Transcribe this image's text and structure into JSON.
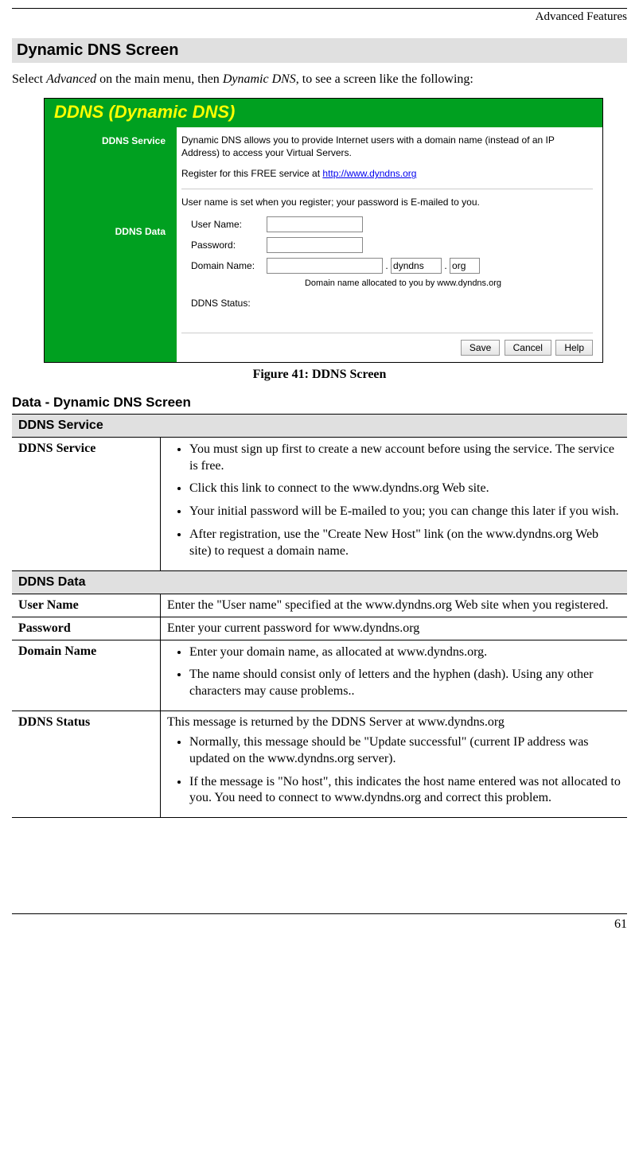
{
  "header": {
    "chapter": "Advanced Features"
  },
  "section": {
    "title": "Dynamic DNS Screen"
  },
  "intro": {
    "pre": "Select ",
    "em1": "Advanced",
    "mid": " on the main menu, then ",
    "em2": "Dynamic DNS",
    "post": ", to see a screen like the following:"
  },
  "screenshot": {
    "title": "DDNS (Dynamic DNS)",
    "side1": "DDNS Service",
    "side2": "DDNS Data",
    "desc1": "Dynamic DNS allows you to provide Internet users with a domain name (instead of an IP Address) to access your Virtual Servers.",
    "desc2a": "Register for this FREE service at ",
    "desc2link": "http://www.dyndns.org",
    "desc3": "User name is set when you register; your password is E-mailed to you.",
    "lbl_user": "User Name:",
    "lbl_pass": "Password:",
    "lbl_domain": "Domain Name:",
    "dom2": "dyndns",
    "dom3": "org",
    "dom_caption": "Domain name allocated to you by www.dyndns.org",
    "lbl_status": "DDNS Status:",
    "btn_save": "Save",
    "btn_cancel": "Cancel",
    "btn_help": "Help"
  },
  "figure": {
    "caption": "Figure 41: DDNS Screen"
  },
  "subsection": {
    "title": "Data - Dynamic DNS Screen"
  },
  "table": {
    "h1": "DDNS Service",
    "r1_label": "DDNS Service",
    "r1_b1": "You must sign up first to create a new account before using the service. The service is free.",
    "r1_b2": "Click this link to connect to the www.dyndns.org Web site.",
    "r1_b3": "Your initial password will be E-mailed to you; you can change this later if you wish.",
    "r1_b4": "After registration, use the \"Create New Host\" link (on the www.dyndns.org Web site) to request a domain name.",
    "h2": "DDNS Data",
    "r2_label": "User Name",
    "r2_text": "Enter the \"User name\" specified at the www.dyndns.org Web site when you registered.",
    "r3_label": "Password",
    "r3_text": "Enter your current password for www.dyndns.org",
    "r4_label": "Domain Name",
    "r4_b1": "Enter your domain name, as allocated at www.dyndns.org.",
    "r4_b2": "The name should consist only of letters and the hyphen (dash). Using any other characters may cause problems..",
    "r5_label": "DDNS Status",
    "r5_text": "This message is returned by the DDNS Server at www.dyndns.org",
    "r5_b1": "Normally, this message should be \"Update successful\" (current IP address was updated on the www.dyndns.org server).",
    "r5_b2": "If the message is \"No host\", this indicates the host name entered was not allocated to you. You need to connect to www.dyndns.org and correct this problem."
  },
  "footer": {
    "page": "61"
  }
}
